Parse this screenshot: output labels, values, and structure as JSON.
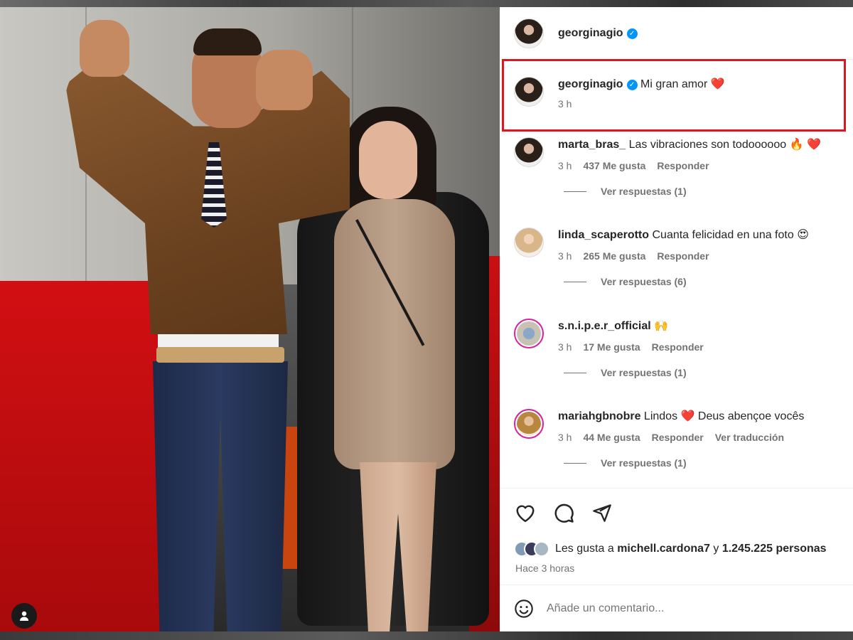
{
  "post": {
    "author": "georginagio",
    "verified_mark": "✓"
  },
  "caption": {
    "author": "georginagio",
    "text": "Mi gran amor",
    "emoji": "❤️",
    "time": "3 h"
  },
  "comments": [
    {
      "author": "marta_bras_",
      "text": "Las vibraciones son todoooooo",
      "emoji": "🔥 ❤️",
      "time": "3 h",
      "likes": "437 Me gusta",
      "reply": "Responder",
      "view_replies": "Ver respuestas (1)"
    },
    {
      "author": "linda_scaperotto",
      "text": "Cuanta felicidad en una foto",
      "emoji": "😍",
      "time": "3 h",
      "likes": "265 Me gusta",
      "reply": "Responder",
      "view_replies": "Ver respuestas (6)"
    },
    {
      "author": "s.n.i.p.e.r_official",
      "text": "",
      "emoji": "🙌",
      "time": "3 h",
      "likes": "17 Me gusta",
      "reply": "Responder",
      "view_replies": "Ver respuestas (1)"
    },
    {
      "author": "mariahgbnobre",
      "text": "Lindos",
      "emoji": "❤️",
      "text2": "Deus abençoe vocês",
      "time": "3 h",
      "likes": "44 Me gusta",
      "reply": "Responder",
      "translate": "Ver traducción",
      "view_replies": "Ver respuestas (1)"
    }
  ],
  "actions": {
    "like_icon": "heart-icon",
    "comment_icon": "comment-icon",
    "share_icon": "paper-plane-icon"
  },
  "likes": {
    "prefix": "Les gusta a",
    "user": "michell.cardona7",
    "joiner": "y",
    "count": "1.245.225 personas"
  },
  "time_ago": "Hace 3 horas",
  "add_comment": {
    "placeholder": "Añade un comentario...",
    "emoji_icon": "smiley-icon"
  },
  "colors": {
    "highlight": "#e0151f",
    "verified": "#0095f6",
    "heart": "#ed1c24"
  }
}
